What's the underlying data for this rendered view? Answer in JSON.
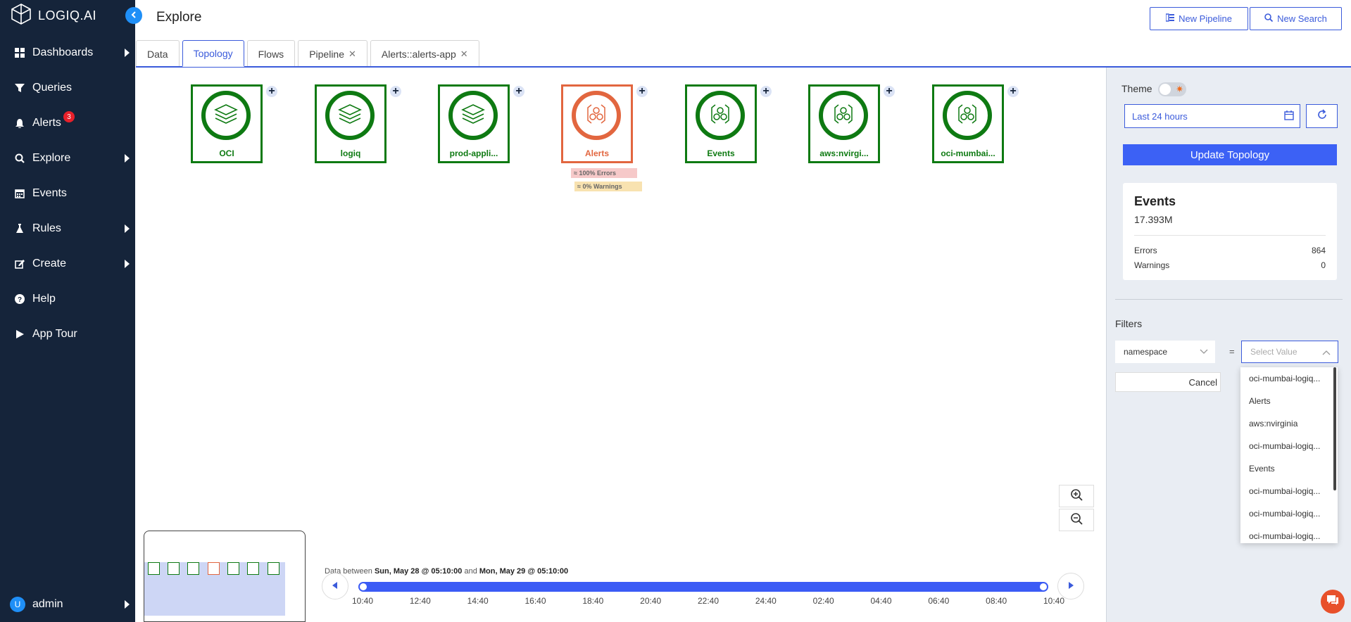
{
  "app": {
    "name": "LOGIQ.AI"
  },
  "sidebar": {
    "items": [
      {
        "label": "Dashboards",
        "icon": "grid-icon",
        "has_arrow": true
      },
      {
        "label": "Queries",
        "icon": "filter-icon",
        "has_arrow": false
      },
      {
        "label": "Alerts",
        "icon": "bell-icon",
        "has_arrow": false,
        "badge": "3"
      },
      {
        "label": "Explore",
        "icon": "search-icon",
        "has_arrow": true
      },
      {
        "label": "Events",
        "icon": "calendar-icon",
        "has_arrow": false
      },
      {
        "label": "Rules",
        "icon": "flask-icon",
        "has_arrow": true
      },
      {
        "label": "Create",
        "icon": "edit-icon",
        "has_arrow": true
      },
      {
        "label": "Help",
        "icon": "question-icon",
        "has_arrow": false
      },
      {
        "label": "App Tour",
        "icon": "play-icon",
        "has_arrow": false
      }
    ],
    "user": {
      "initial": "U",
      "name": "admin"
    }
  },
  "header": {
    "title": "Explore",
    "new_pipeline_label": "New Pipeline",
    "new_search_label": "New Search"
  },
  "tabs": [
    {
      "label": "Data",
      "active": false,
      "closable": false
    },
    {
      "label": "Topology",
      "active": true,
      "closable": false
    },
    {
      "label": "Flows",
      "active": false,
      "closable": false
    },
    {
      "label": "Pipeline",
      "active": false,
      "closable": true
    },
    {
      "label": "Alerts::alerts-app",
      "active": false,
      "closable": true
    }
  ],
  "topology": {
    "nodes": [
      {
        "label": "OCI",
        "status": "ok",
        "icon": "layers-icon"
      },
      {
        "label": "logiq",
        "status": "ok",
        "icon": "layers-icon"
      },
      {
        "label": "prod-appli...",
        "status": "ok",
        "icon": "layers-icon"
      },
      {
        "label": "Alerts",
        "status": "error",
        "icon": "hexagon-cluster-icon"
      },
      {
        "label": "Events",
        "status": "ok",
        "icon": "hexagon-cluster-icon"
      },
      {
        "label": "aws:nvirgi...",
        "status": "ok",
        "icon": "hexagon-cluster-icon"
      },
      {
        "label": "oci-mumbai...",
        "status": "ok",
        "icon": "hexagon-cluster-icon"
      }
    ],
    "alerts_errors_label": "≈ 100% Errors",
    "alerts_warnings_label": "≈ 0% Warnings"
  },
  "timeline": {
    "prefix": "Data between",
    "start": "Sun, May 28 @ 05:10:00",
    "conj": "and",
    "end": "Mon, May 29 @ 05:10:00",
    "ticks": [
      "10:40",
      "12:40",
      "14:40",
      "16:40",
      "18:40",
      "20:40",
      "22:40",
      "24:40",
      "02:40",
      "04:40",
      "06:40",
      "08:40",
      "10:40"
    ]
  },
  "panel": {
    "theme_label": "Theme",
    "date_range": "Last 24 hours",
    "update_label": "Update Topology",
    "card": {
      "title": "Events",
      "total": "17.393M",
      "errors_label": "Errors",
      "errors_value": "864",
      "warnings_label": "Warnings",
      "warnings_value": "0"
    },
    "filters_label": "Filters",
    "filter_key": "namespace",
    "eq": "=",
    "value_placeholder": "Select Value",
    "cancel_label": "Cancel",
    "dropdown_options": [
      "oci-mumbai-logiq...",
      "Alerts",
      "aws:nvirginia",
      "oci-mumbai-logiq...",
      "Events",
      "oci-mumbai-logiq...",
      "oci-mumbai-logiq...",
      "oci-mumbai-logiq..."
    ]
  },
  "colors": {
    "sidebar_bg": "#15243a",
    "accent": "#3b5bdb",
    "ok": "#0e7a12",
    "error": "#e2663f"
  }
}
